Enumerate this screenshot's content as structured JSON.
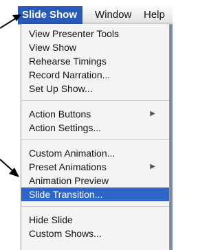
{
  "menubar": {
    "items": [
      {
        "label": "Slide Show",
        "active": true
      },
      {
        "label": "Window"
      },
      {
        "label": "Help"
      }
    ]
  },
  "menu": {
    "items": [
      {
        "label": "View Presenter Tools"
      },
      {
        "label": "View Show"
      },
      {
        "label": "Rehearse Timings"
      },
      {
        "label": "Record Narration..."
      },
      {
        "label": "Set Up Show..."
      },
      {
        "label": "Action Buttons",
        "submenu_icon": "submenu-arrow-icon",
        "arrow": "▶"
      },
      {
        "label": "Action Settings..."
      },
      {
        "label": "Custom Animation..."
      },
      {
        "label": "Preset Animations",
        "submenu_icon": "submenu-arrow-icon",
        "arrow": "▶"
      },
      {
        "label": "Animation Preview"
      },
      {
        "label": "Slide Transition...",
        "highlighted": true
      },
      {
        "label": "Hide Slide"
      },
      {
        "label": "Custom Shows..."
      }
    ]
  },
  "colors": {
    "highlight": "#2f64c8",
    "menubar_active": "#2a5ab8",
    "pointer": "#000000"
  },
  "pointers": [
    {
      "name": "pointer-arrow-top",
      "icon": "arrow-pointer-icon"
    },
    {
      "name": "pointer-arrow-bottom",
      "icon": "arrow-pointer-icon"
    }
  ]
}
